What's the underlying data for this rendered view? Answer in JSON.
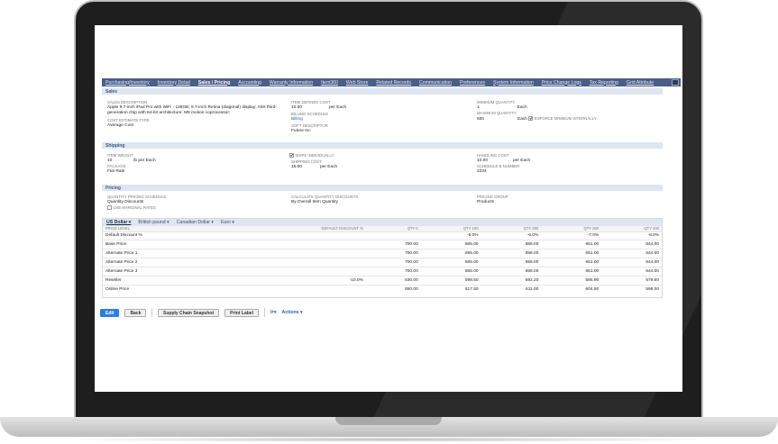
{
  "tabs": [
    "Purchasing/Inventory",
    "Inventory Detail",
    "Sales / Pricing",
    "Accounting",
    "Warranty Information",
    "Item360",
    "Web Store",
    "Related Records",
    "Communication",
    "Preferences",
    "System Information",
    "Price Change Logs",
    "Tax Reporting",
    "Grid Attribute"
  ],
  "active_tab": "Sales / Pricing",
  "sales": {
    "title": "Sales",
    "sales_description_label": "Sales Description",
    "sales_description": "Apple 9.7-inch iPad Pro with WiFi - 128GB; 9.7-inch Retina (diagonal) display; A9X third-generation chip with 64-bit architecture; M9 motion coprocessor;",
    "cost_estimate_type_label": "Cost Estimate Type",
    "cost_estimate_type": "Average Cost",
    "item_defined_cost_label": "Item Defined Cost",
    "item_defined_cost": "10.00",
    "item_defined_cost_unit": "per Each",
    "billing_schedule_label": "Billing Schedule",
    "billing_schedule": "Billing",
    "soft_descriptor_label": "Soft Descriptor",
    "soft_descriptor": "Future Inc",
    "minimum_quantity_label": "Minimum Quantity",
    "minimum_quantity": "1",
    "minimum_unit": "Each",
    "maximum_quantity_label": "Maximum Quantity",
    "maximum_quantity": "500",
    "maximum_unit": "Each",
    "enforce_minimum_label": "Enforce Minimum Internally",
    "enforce_minimum": true
  },
  "shipping": {
    "title": "Shipping",
    "item_weight_label": "Item Weight",
    "item_weight": "10",
    "item_weight_unit": "lb",
    "item_weight_per": "per Each",
    "package_label": "Package",
    "package": "Flat Rate",
    "ships_individually_label": "Ships Individually",
    "ships_individually": true,
    "shipping_cost_label": "Shipping Cost",
    "shipping_cost": "15.00",
    "shipping_cost_unit": "per Each",
    "handling_cost_label": "Handling Cost",
    "handling_cost": "10.00",
    "handling_cost_unit": "per Each",
    "schedule_b_label": "Schedule B Number",
    "schedule_b": "2234"
  },
  "pricing": {
    "title": "Pricing",
    "qps_label": "Quantity Pricing Schedule",
    "qps": "Quantity Discounts",
    "marginal_label": "Use Marginal Rates",
    "marginal": false,
    "cqd_label": "Calculate Quantity Discounts",
    "cqd": "By Overall Item Quantity",
    "pricing_group_label": "Pricing Group",
    "pricing_group": "Products"
  },
  "currencies": [
    "US Dollar",
    "British pound",
    "Canadian Dollar",
    "Euro"
  ],
  "selected_currency": "US Dollar",
  "price_table": {
    "headers": [
      "Price Level",
      "Default Discount %",
      "Qty 0",
      "Qty 100",
      "Qty 200",
      "Qty 300",
      "Qty 400"
    ],
    "rows": [
      [
        "Default Discount %",
        "",
        "",
        "-5.0%",
        "-6.0%",
        "-7.0%",
        "-8.0%"
      ],
      [
        "Base Price",
        "",
        "700.00",
        "665.00",
        "658.00",
        "651.00",
        "644.00"
      ],
      [
        "Alternate Price 1",
        "",
        "700.00",
        "665.00",
        "658.00",
        "651.00",
        "644.00"
      ],
      [
        "Alternate Price 2",
        "",
        "700.00",
        "665.00",
        "658.00",
        "651.00",
        "644.00"
      ],
      [
        "Alternate Price 3",
        "",
        "700.00",
        "665.00",
        "658.00",
        "651.00",
        "644.00"
      ],
      [
        "Reseller",
        "-10.0%",
        "630.00",
        "598.50",
        "592.20",
        "585.90",
        "579.60"
      ],
      [
        "Online Price",
        "",
        "650.00",
        "617.50",
        "611.00",
        "604.50",
        "598.00"
      ]
    ]
  },
  "buttons": {
    "edit": "Edit",
    "back": "Back",
    "supply_chain": "Supply Chain Snapshot",
    "print_label": "Print Label",
    "actions": "Actions ▾"
  }
}
